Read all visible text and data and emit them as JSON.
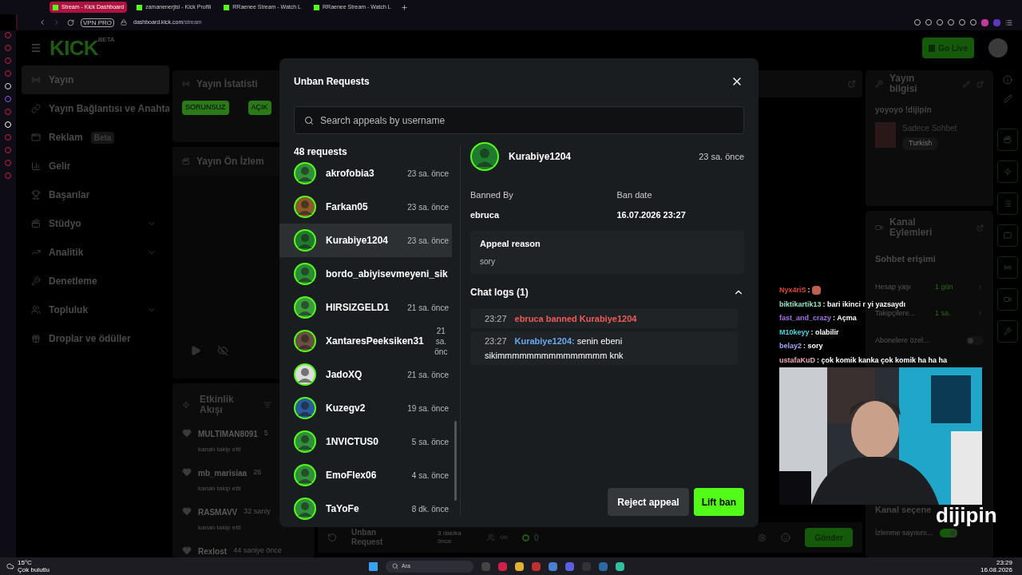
{
  "browser": {
    "tabs": [
      {
        "label": "Stream - Kick Dashboard",
        "selected": true
      },
      {
        "label": "zamanenerjisi - Kick Profili",
        "selected": false
      },
      {
        "label": "RRaenee Stream - Watch L",
        "selected": false
      },
      {
        "label": "RRaenee Stream - Watch L",
        "selected": false
      }
    ],
    "vpn": "VPN PRO",
    "url_host": "dashboard.kick.com",
    "url_path": "/stream"
  },
  "header": {
    "logo": "KICK",
    "logo_badge": "BETA",
    "go_live": "Go Live"
  },
  "nav": [
    {
      "label": "Yayın",
      "selected": true,
      "chevron": false
    },
    {
      "label": "Yayın Bağlantısı ve Anahta",
      "selected": false,
      "chevron": false
    },
    {
      "label": "Reklam",
      "selected": false,
      "chevron": false,
      "badge": "Beta"
    },
    {
      "label": "Gelir",
      "selected": false,
      "chevron": false
    },
    {
      "label": "Başarılar",
      "selected": false,
      "chevron": false
    },
    {
      "label": "Stüdyo",
      "selected": false,
      "chevron": true
    },
    {
      "label": "Analitik",
      "selected": false,
      "chevron": true
    },
    {
      "label": "Denetleme",
      "selected": false,
      "chevron": false
    },
    {
      "label": "Topluluk",
      "selected": false,
      "chevron": true
    },
    {
      "label": "Droplar ve ödüller",
      "selected": false,
      "chevron": false
    }
  ],
  "stats_panel": {
    "title": "Yayın İstatisti",
    "badges": [
      "SORUNSUZ",
      "AÇIK"
    ]
  },
  "preview_panel": {
    "title": "Yayın Ön İzlem"
  },
  "activity": {
    "title": "Etkinlik Akışı",
    "events": [
      {
        "user": "MULTIMAN8091",
        "time": "5",
        "text": "kanalı takip etti"
      },
      {
        "user": "mb_marisiaa",
        "time": "26",
        "text": "kanalı takip etti"
      },
      {
        "user": "RASMAVV",
        "time": "32 saniy",
        "text": "kanalı takip etti"
      },
      {
        "user": "Rexlost",
        "time": "44 saniye önce"
      }
    ]
  },
  "bottom_row": {
    "unban_label": "Unban Request",
    "unban_time": "3 dakika önce",
    "count": "0",
    "send": "Gönder"
  },
  "stream_info": {
    "title": "Yayın bilgisi",
    "stream_title": "yoyoyo !dijipin",
    "category": "Sadece Sohbet",
    "tag": "Turkish"
  },
  "channel_actions": {
    "title": "Kanal Eylemleri",
    "section": "Sohbet erişimi",
    "rows": [
      {
        "kind": "value",
        "label": "Hesap yaşı",
        "value": "1 gün"
      },
      {
        "kind": "value",
        "label": "Takipçilere...",
        "value": "1 sa."
      },
      {
        "kind": "toggle",
        "label": "Abonelere özel...",
        "on": false
      }
    ],
    "more_title": "Kanal seçene",
    "views_label": "İzlenme sayısını...",
    "views_on": true
  },
  "overlay_chat": [
    {
      "user": "Nyx4riS",
      "color": "#e2452e",
      "text": ":",
      "emote": true
    },
    {
      "user": "biktikartik13",
      "color": "#8ee6c4",
      "text": ": bari ikinci r yi yazsaydı",
      "emote": false
    },
    {
      "user": "fast_and_crazy",
      "color": "#a66ee8",
      "text": ": Açma",
      "emote": false
    },
    {
      "user": "M10keyy",
      "color": "#3fd6e6",
      "text": ": olabilir",
      "emote": false
    },
    {
      "user": "belay2",
      "color": "#a5a5ff",
      "text": ": sory",
      "emote": false
    },
    {
      "user": "ustafaKuD",
      "color": "#f0a8b8",
      "text": ": çok komik kanka çok komik ha ha ha",
      "emote": false
    }
  ],
  "overlay_logo": "dijipin",
  "modal": {
    "title": "Unban Requests",
    "search_placeholder": "Search appeals by username",
    "count": "48 requests",
    "requests": [
      {
        "user": "akrofobia3",
        "time": "23 sa. önce",
        "selected": false
      },
      {
        "user": "Farkan05",
        "time": "23 sa. önce",
        "selected": false
      },
      {
        "user": "Kurabiye1204",
        "time": "23 sa. önce",
        "selected": true
      },
      {
        "user": "bordo_abiyisevmeyeni_sik",
        "selected": false
      },
      {
        "user": "HIRSIZGELD1",
        "time": "21 sa. önce",
        "selected": false
      },
      {
        "user": "XantaresPeeksiken31",
        "time": "21 sa. önc",
        "selected": false
      },
      {
        "user": "JadoXQ",
        "time": "21 sa. önce",
        "selected": false
      },
      {
        "user": "Kuzegv2",
        "time": "19 sa. önce",
        "selected": false
      },
      {
        "user": "1NVICTUS0",
        "time": "5 sa. önce",
        "selected": false
      },
      {
        "user": "EmoFlex06",
        "time": "4 sa. önce",
        "selected": false
      },
      {
        "user": "TaYoFe",
        "time": "8 dk. önce",
        "selected": false
      }
    ],
    "detail": {
      "user": "Kurabiye1204",
      "time": "23 sa. önce",
      "banned_by_label": "Banned By",
      "banned_by": "ebruca",
      "ban_date_label": "Ban date",
      "ban_date": "16.07.2026 23:27",
      "appeal_label": "Appeal reason",
      "appeal": "sory",
      "logs_title": "Chat logs (1)",
      "logs_expanded": true,
      "logs": [
        {
          "kind": "ban",
          "time": "23:27",
          "text": "ebruca banned Kurabiye1204"
        },
        {
          "kind": "message",
          "time": "23:27",
          "user": "Kurabiye1204:",
          "text": "senin ebeni sikimmmmmmmmmmmmmmm knk"
        }
      ]
    },
    "reject": "Reject appeal",
    "lift": "Lift ban"
  },
  "taskbar": {
    "temp": "15°C",
    "weather": "Çok bulutlu",
    "search": "Ara",
    "time": "23:29",
    "date": "16.08.2026"
  }
}
